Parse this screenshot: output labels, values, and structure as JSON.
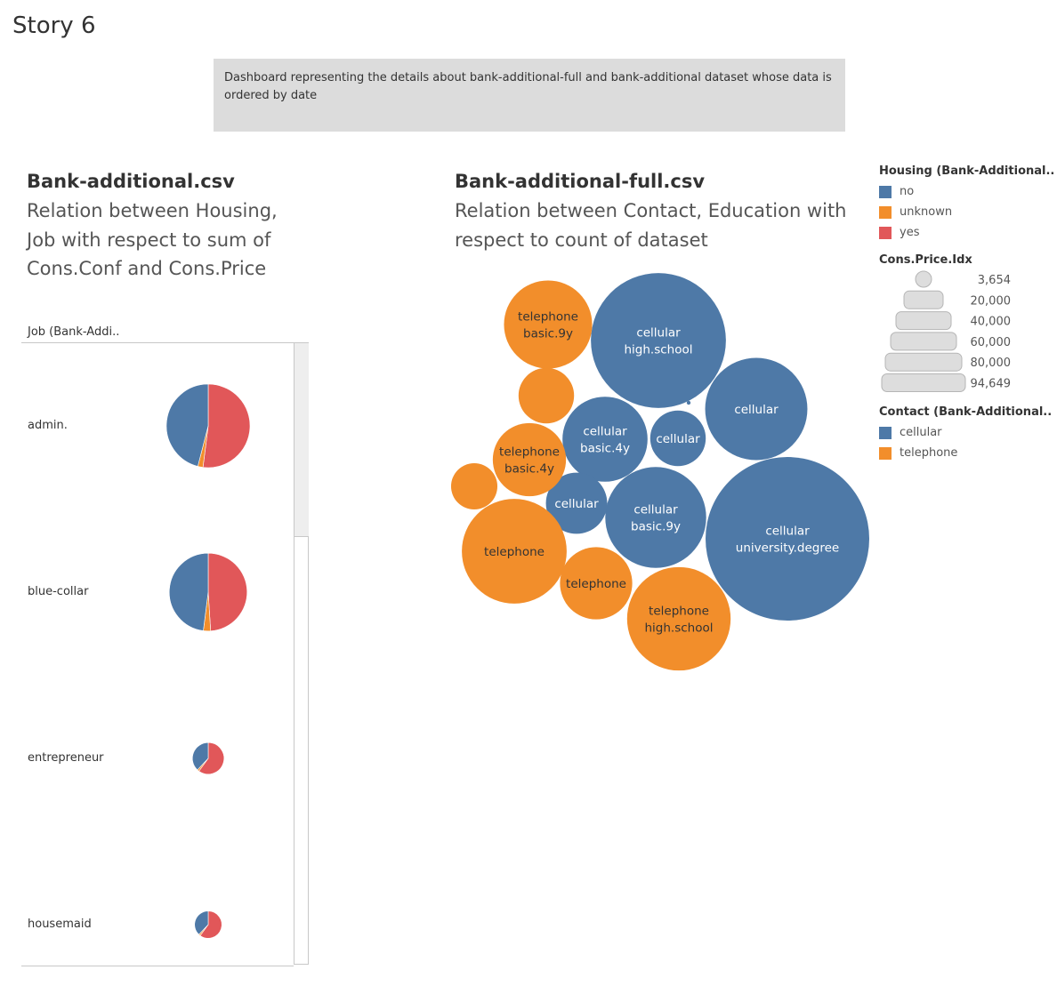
{
  "story_title": "Story 6",
  "description": "Dashboard representing the details about bank-additional-full and bank-additional dataset whose data is ordered by date",
  "colors": {
    "no": "#4e79a7",
    "unknown": "#f28e2b",
    "yes": "#e15759",
    "cellular": "#4e79a7",
    "telephone": "#f28e2b"
  },
  "left_sheet": {
    "title": "Bank-additional.csv",
    "subtitle": "Relation between Housing, Job with respect to sum of Cons.Conf and Cons.Price",
    "column_header": "Job (Bank-Addi.."
  },
  "right_sheet": {
    "title": "Bank-additional-full.csv",
    "subtitle": "Relation between Contact, Education with respect to count of dataset"
  },
  "legends": {
    "housing": {
      "title": "Housing (Bank-Additional..",
      "items": [
        {
          "label": "no",
          "color": "#4e79a7"
        },
        {
          "label": "unknown",
          "color": "#f28e2b"
        },
        {
          "label": "yes",
          "color": "#e15759"
        }
      ]
    },
    "size": {
      "title": "Cons.Price.Idx",
      "items": [
        "3,654",
        "20,000",
        "40,000",
        "60,000",
        "80,000",
        "94,649"
      ]
    },
    "contact": {
      "title": "Contact (Bank-Additional..",
      "items": [
        {
          "label": "cellular",
          "color": "#4e79a7"
        },
        {
          "label": "telephone",
          "color": "#f28e2b"
        }
      ]
    }
  },
  "chart_data": [
    {
      "type": "pie",
      "category_field": "Job (Bank-Addi..",
      "color_field": "Housing (Bank-Additional..",
      "size_field": "Cons.Price.Idx",
      "slice_order": [
        "no",
        "unknown",
        "yes"
      ],
      "rows": [
        {
          "job": "admin.",
          "size": 94649,
          "shares": {
            "no": 0.46,
            "unknown": 0.02,
            "yes": 0.52
          }
        },
        {
          "job": "blue-collar",
          "size": 82000,
          "shares": {
            "no": 0.48,
            "unknown": 0.03,
            "yes": 0.49
          }
        },
        {
          "job": "entrepreneur",
          "size": 13500,
          "shares": {
            "no": 0.38,
            "unknown": 0.02,
            "yes": 0.6
          }
        },
        {
          "job": "housemaid",
          "size": 10000,
          "shares": {
            "no": 0.38,
            "unknown": 0.02,
            "yes": 0.6
          }
        }
      ]
    },
    {
      "type": "bubble",
      "color_field": "Contact (Bank-Additional..",
      "bubbles": [
        {
          "contact": "cellular",
          "education": "university.degree",
          "label": [
            "cellular",
            "university.degree"
          ],
          "value": 100
        },
        {
          "contact": "cellular",
          "education": "high.school",
          "label": [
            "cellular",
            "high.school"
          ],
          "value": 68
        },
        {
          "contact": "cellular",
          "education": "",
          "label": [
            "cellular"
          ],
          "value": 39
        },
        {
          "contact": "cellular",
          "education": "basic.9y",
          "label": [
            "cellular",
            "basic.9y"
          ],
          "value": 38
        },
        {
          "contact": "cellular",
          "education": "basic.4y",
          "label": [
            "cellular",
            "basic.4y"
          ],
          "value": 27
        },
        {
          "contact": "cellular",
          "education": "",
          "label": [
            "cellular"
          ],
          "value": 14
        },
        {
          "contact": "cellular",
          "education": "",
          "label": [
            "cellular"
          ],
          "value": 11.5
        },
        {
          "contact": "cellular",
          "education": "",
          "label": [],
          "value": 0.05
        },
        {
          "contact": "telephone",
          "education": "high.school",
          "label": [
            "telephone",
            "high.school"
          ],
          "value": 40
        },
        {
          "contact": "telephone",
          "education": "",
          "label": [
            "telephone"
          ],
          "value": 41
        },
        {
          "contact": "telephone",
          "education": "basic.9y",
          "label": [
            "telephone",
            "basic.9y"
          ],
          "value": 29
        },
        {
          "contact": "telephone",
          "education": "",
          "label": [
            "telephone"
          ],
          "value": 19.5
        },
        {
          "contact": "telephone",
          "education": "basic.4y",
          "label": [
            "telephone",
            "basic.4y"
          ],
          "value": 20
        },
        {
          "contact": "telephone",
          "education": "",
          "label": [],
          "value": 11.5
        },
        {
          "contact": "telephone",
          "education": "",
          "label": [],
          "value": 8
        }
      ]
    }
  ]
}
